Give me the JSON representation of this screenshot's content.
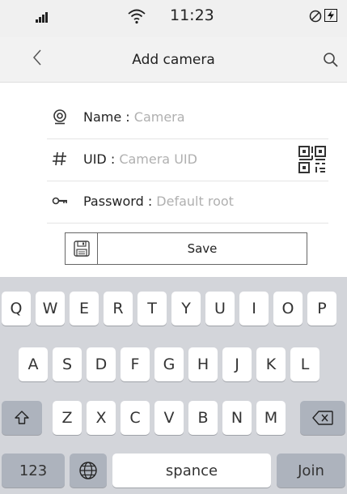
{
  "status_bar": {
    "time": "11:23"
  },
  "nav": {
    "title": "Add camera"
  },
  "form": {
    "fields": [
      {
        "label": "Name : ",
        "value": "Camera"
      },
      {
        "label": "UID : ",
        "value": "Camera UID"
      },
      {
        "label": "Password : ",
        "value": "Default root"
      }
    ],
    "save_label": "Save"
  },
  "keyboard": {
    "row1": [
      "Q",
      "W",
      "E",
      "R",
      "T",
      "Y",
      "U",
      "I",
      "O",
      "P"
    ],
    "row2": [
      "A",
      "S",
      "D",
      "F",
      "G",
      "H",
      "J",
      "K",
      "L"
    ],
    "row3": [
      "Z",
      "X",
      "C",
      "V",
      "B",
      "N",
      "M"
    ],
    "numbers_label": "123",
    "space_label": "spance",
    "join_label": "Join"
  },
  "colors": {
    "background": "#ffffff",
    "header": "#f2f2f2",
    "keyboard": "#d3d5da",
    "key": "#ffffff",
    "placeholder": "#b0b0b0"
  }
}
